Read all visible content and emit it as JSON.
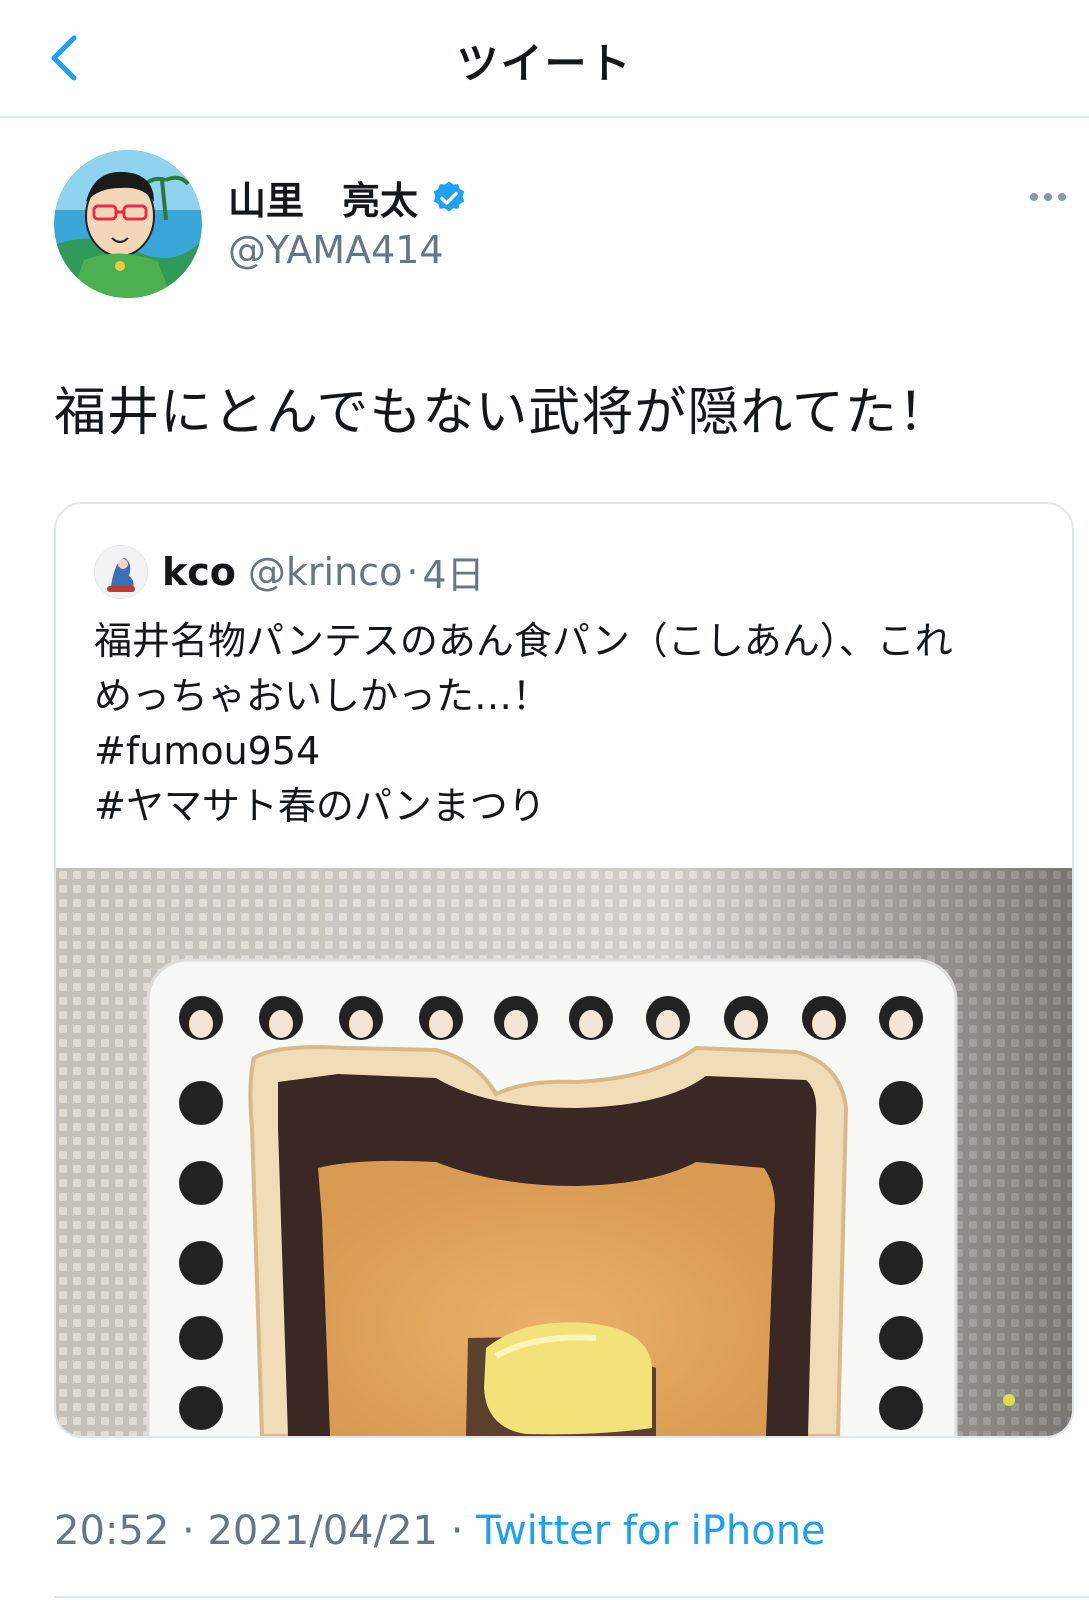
{
  "nav": {
    "title": "ツイート",
    "back_icon": "chevron-left-icon"
  },
  "author": {
    "name": "山里　亮太",
    "handle": "@YAMA414",
    "verified_icon": "verified-badge-icon",
    "more_icon": "more-horizontal-icon"
  },
  "tweet": {
    "text": "福井にとんでもない武将が隠れてた！"
  },
  "quote": {
    "name": "kco",
    "handle": "@krinco",
    "dot": "·",
    "time": "4日",
    "lines": [
      "福井名物パンテスのあん食パン（こしあん）、これ",
      "めっちゃおいしかった…！",
      "#fumou954",
      "#ヤマサト春のパンまつり"
    ]
  },
  "footer": {
    "time": "20:52",
    "sep1": " · ",
    "date": "2021/04/21",
    "sep2": " · ",
    "source": "Twitter for iPhone"
  },
  "colors": {
    "accent": "#1da1f2",
    "secondary_text": "#657786",
    "border": "#e1e8ed"
  }
}
